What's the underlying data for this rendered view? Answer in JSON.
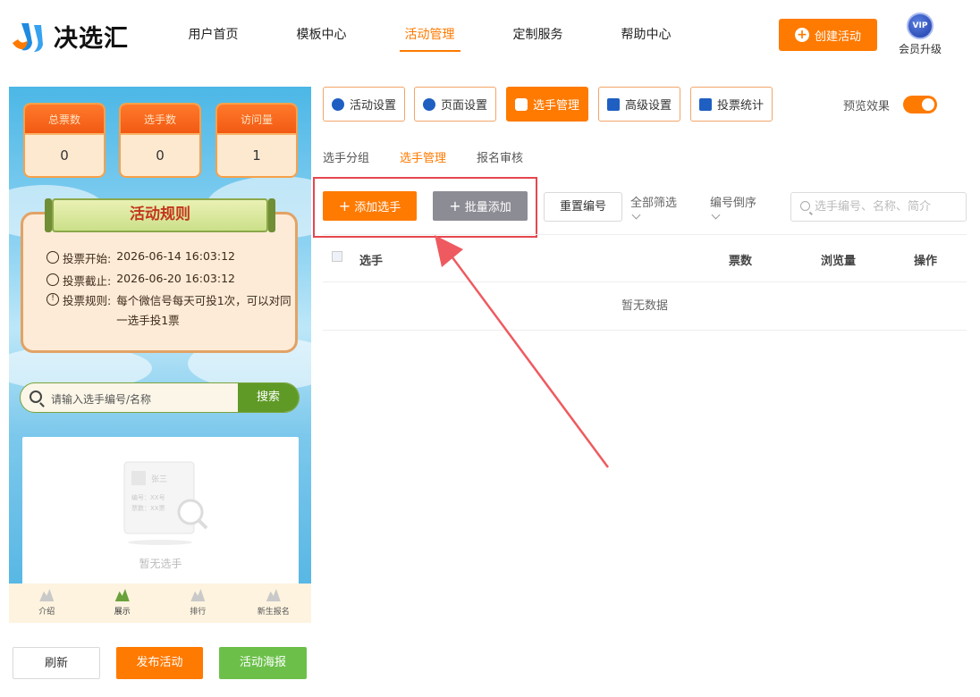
{
  "brand": {
    "name": "决选汇"
  },
  "nav": [
    {
      "label": "用户首页"
    },
    {
      "label": "模板中心"
    },
    {
      "label": "活动管理",
      "active": true
    },
    {
      "label": "定制服务"
    },
    {
      "label": "帮助中心"
    }
  ],
  "header": {
    "create_label": "创建活动",
    "vip_badge": "VIP",
    "vip_label": "会员升级"
  },
  "preview": {
    "stats": [
      {
        "label": "总票数",
        "value": "0"
      },
      {
        "label": "选手数",
        "value": "0"
      },
      {
        "label": "访问量",
        "value": "1"
      }
    ],
    "rules_title": "活动规则",
    "rules": [
      {
        "label": "投票开始:",
        "value": "2026-06-14 16:03:12"
      },
      {
        "label": "投票截止:",
        "value": "2026-06-20 16:03:12"
      },
      {
        "label": "投票规则:",
        "value": "每个微信号每天可投1次，可以对同一选手投1票"
      }
    ],
    "search_placeholder": "请输入选手编号/名称",
    "search_button": "搜索",
    "empty_text": "暂无选手",
    "tabs": [
      {
        "label": "介绍"
      },
      {
        "label": "展示",
        "selected": true
      },
      {
        "label": "排行"
      },
      {
        "label": "新生报名"
      }
    ]
  },
  "bottom_buttons": {
    "refresh": "刷新",
    "publish": "发布活动",
    "poster": "活动海报"
  },
  "settings_tabs": [
    {
      "label": "活动设置"
    },
    {
      "label": "页面设置"
    },
    {
      "label": "选手管理",
      "active": true
    },
    {
      "label": "高级设置"
    },
    {
      "label": "投票统计"
    }
  ],
  "preview_toggle": {
    "label": "预览效果",
    "on": true
  },
  "subtabs": [
    {
      "label": "选手分组"
    },
    {
      "label": "选手管理",
      "active": true
    },
    {
      "label": "报名审核"
    }
  ],
  "actions": {
    "add_player": "添加选手",
    "batch_add": "批量添加",
    "reset_number": "重置编号",
    "filter_all": "全部筛选",
    "sort_desc": "编号倒序",
    "search_placeholder": "选手编号、名称、简介"
  },
  "table": {
    "columns": [
      "选手",
      "票数",
      "浏览量",
      "操作"
    ],
    "empty": "暂无数据"
  },
  "colors": {
    "accent": "#ff7a00",
    "annotation": "#e5474f",
    "green": "#6cc04a",
    "gray_button": "#8c8c94"
  }
}
